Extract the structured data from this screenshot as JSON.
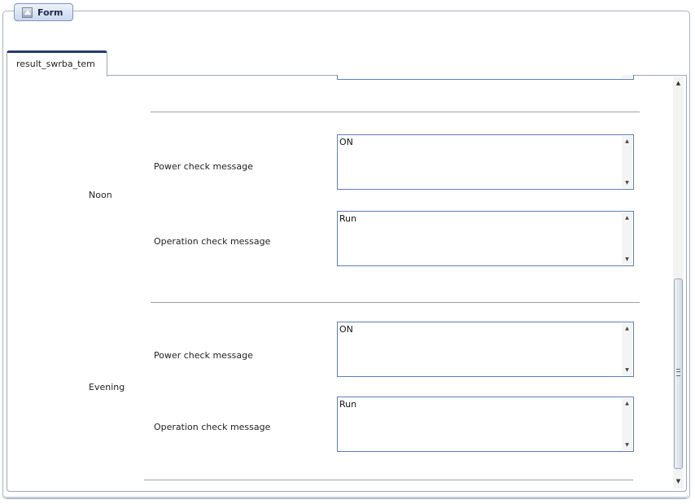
{
  "form": {
    "button_label": "Form",
    "icon": "up-arrow-icon"
  },
  "tab": {
    "label": "result_swrba_tem"
  },
  "sections": [
    {
      "label": "Noon",
      "fields": [
        {
          "label": "Power check message",
          "value": "ON"
        },
        {
          "label": "Operation check message",
          "value": "Run"
        }
      ]
    },
    {
      "label": "Evening",
      "fields": [
        {
          "label": "Power check message",
          "value": "ON"
        },
        {
          "label": "Operation check message",
          "value": "Run"
        }
      ]
    }
  ],
  "colors": {
    "accent": "#243c6a",
    "field_border": "#5d7fb2",
    "separator": "#a0a0a0"
  }
}
